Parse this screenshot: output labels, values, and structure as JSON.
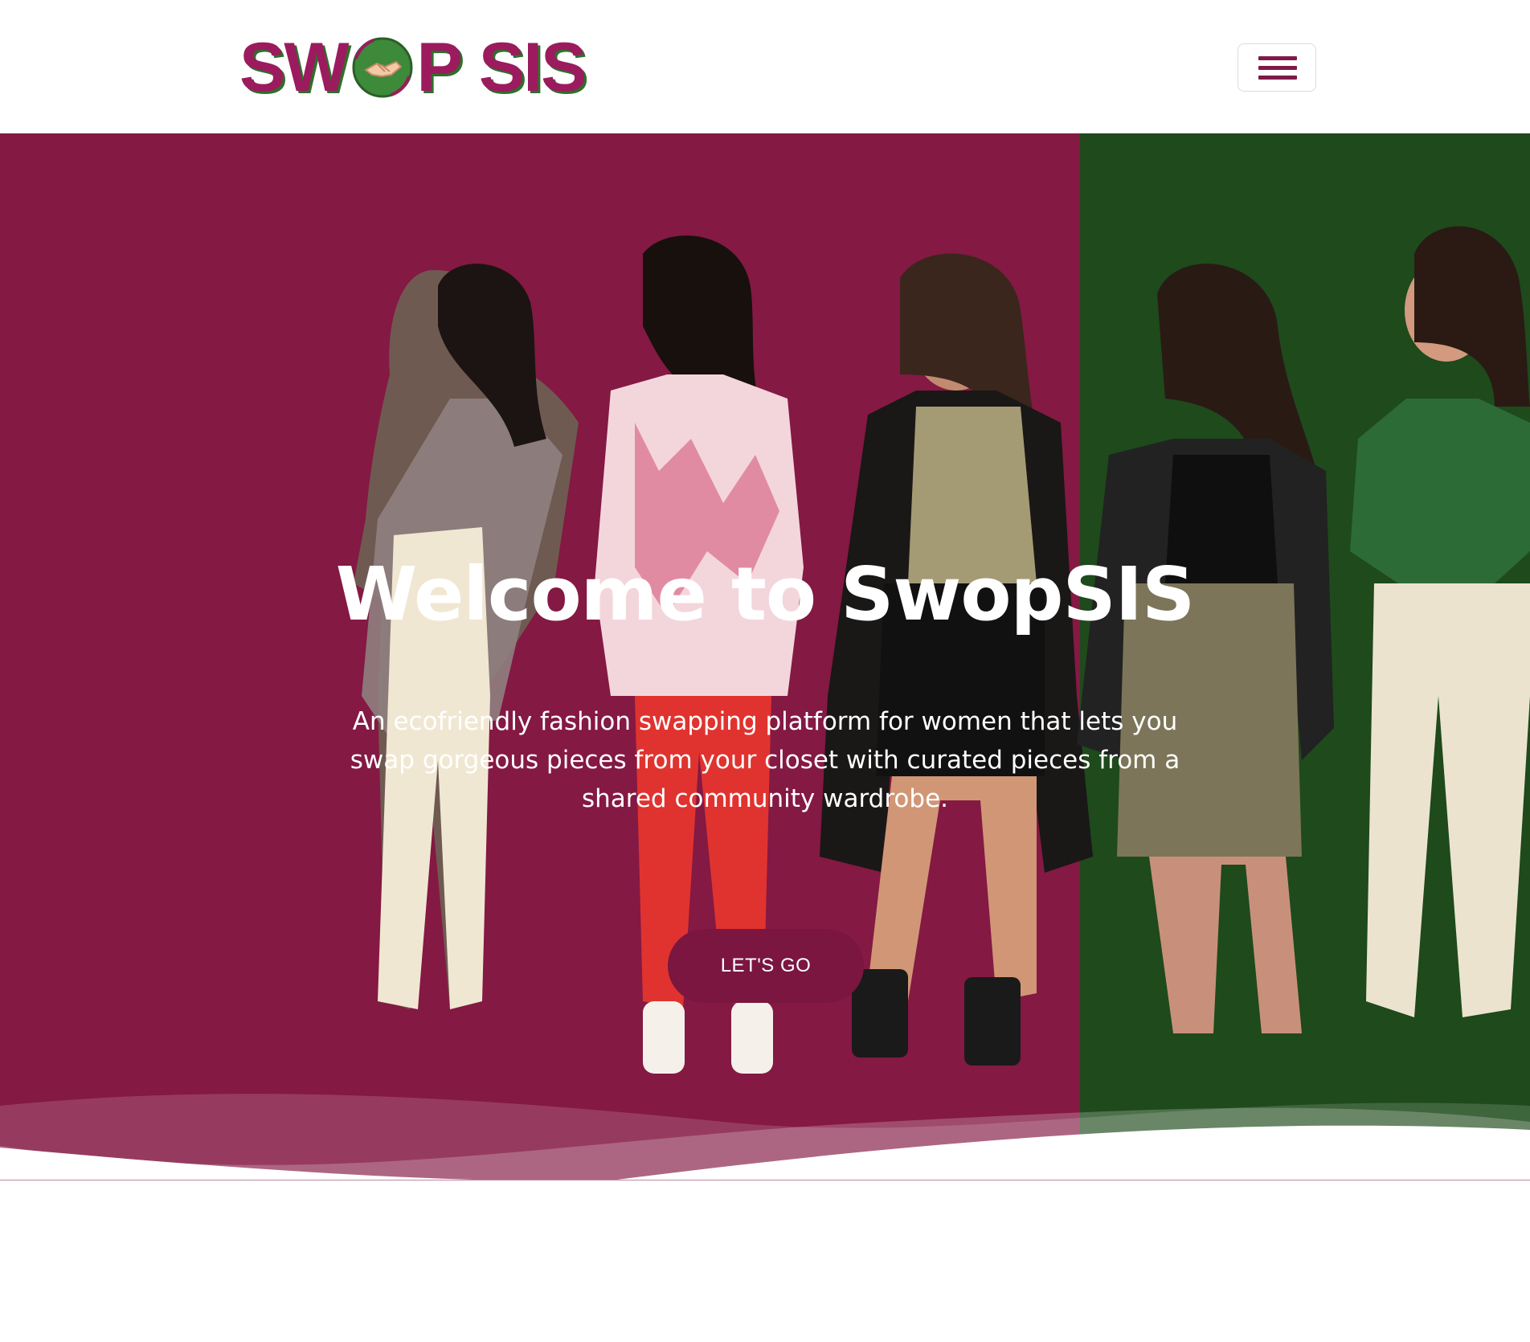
{
  "navbar": {
    "brand_part1": "SW",
    "brand_part2": "P",
    "brand_part3": "SIS",
    "toggler_icon": "hamburger-menu-icon"
  },
  "hero": {
    "title": "Welcome to SwopSIS",
    "subtitle": "An ecofriendly fashion swapping platform for women that lets you swap gorgeous pieces from your closet with curated pieces from a shared community wardrobe.",
    "cta_label": "LET'S GO"
  },
  "colors": {
    "brand_magenta": "#841943",
    "brand_green": "#1e4a1c",
    "cta": "#7a1640",
    "logo_text": "#9b1b5e",
    "logo_shadow": "#2f6e2b"
  }
}
